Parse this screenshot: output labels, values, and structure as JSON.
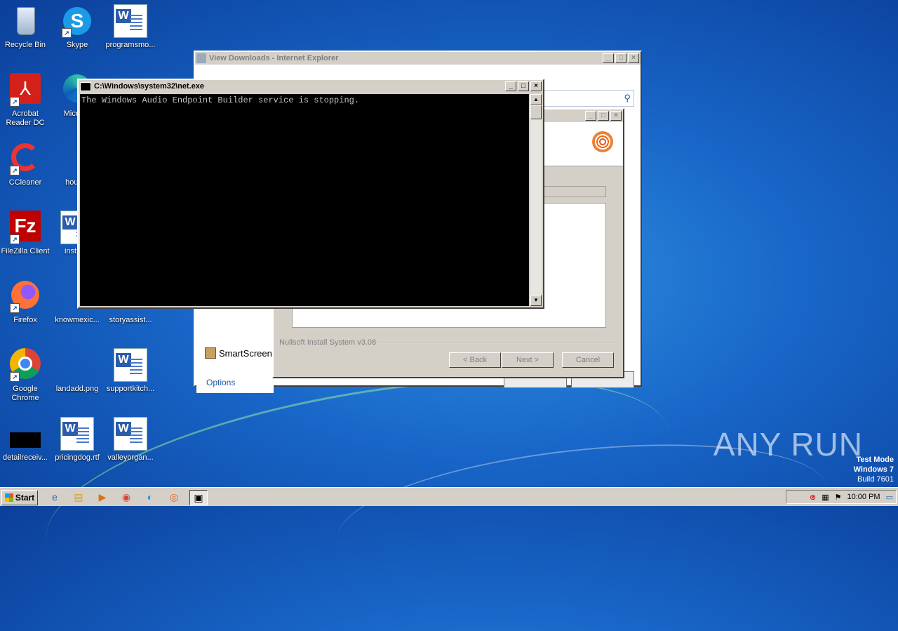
{
  "desktop_icons": [
    {
      "label": "Recycle Bin",
      "icon": "recycle-bin-icon"
    },
    {
      "label": "Skype",
      "icon": "skype-icon"
    },
    {
      "label": "programsmo...",
      "icon": "word-doc-icon"
    },
    {
      "label": "Acrobat Reader DC",
      "icon": "acrobat-icon"
    },
    {
      "label": "Microso",
      "icon": "edge-icon"
    },
    {
      "label": "CCleaner",
      "icon": "ccleaner-icon"
    },
    {
      "label": "hoursb",
      "icon": "file-icon"
    },
    {
      "label": "FileZilla Client",
      "icon": "filezilla-icon"
    },
    {
      "label": "instrum",
      "icon": "word-doc-icon"
    },
    {
      "label": "Firefox",
      "icon": "firefox-icon"
    },
    {
      "label": "knowmexic...",
      "icon": "file-icon"
    },
    {
      "label": "storyassist...",
      "icon": "file-icon"
    },
    {
      "label": "Google Chrome",
      "icon": "chrome-icon"
    },
    {
      "label": "landadd.png",
      "icon": "image-icon"
    },
    {
      "label": "supportkitch...",
      "icon": "word-doc-icon"
    },
    {
      "label": "detailreceiv...",
      "icon": "black-file-icon"
    },
    {
      "label": "pricingdog.rtf",
      "icon": "word-doc-icon"
    },
    {
      "label": "valleyorgan...",
      "icon": "word-doc-icon"
    }
  ],
  "ie_window": {
    "title": "View Downloads - Internet Explorer",
    "smartscreen_label": "SmartScreen",
    "options_link": "Options"
  },
  "nsis_window": {
    "footer": "Nullsoft Install System v3.08",
    "back_button": "< Back",
    "next_button": "Next >",
    "cancel_button": "Cancel"
  },
  "console_window": {
    "title": "C:\\Windows\\system32\\net.exe",
    "output": "The Windows Audio Endpoint Builder service is stopping."
  },
  "watermark": "ANY  RUN",
  "test_mode": {
    "line1": "Test Mode",
    "line2": "Windows 7",
    "line3": "Build 7601"
  },
  "taskbar": {
    "start_label": "Start",
    "clock": "10:00 PM"
  }
}
